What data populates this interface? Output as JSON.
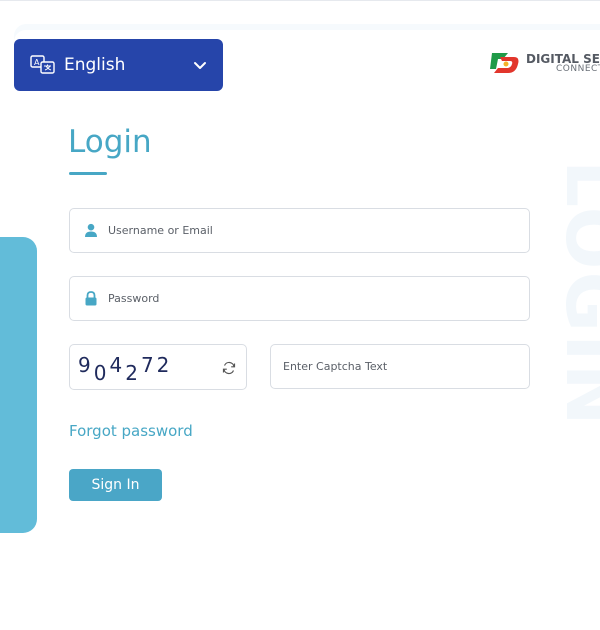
{
  "language": {
    "selected": "English",
    "icon": "translate-icon",
    "chevron": "chevron-down-icon"
  },
  "brand": {
    "title": "DIGITAL SEVA",
    "subtitle": "CONNECT"
  },
  "watermark": "LOGIN",
  "login": {
    "title": "Login",
    "username_placeholder": "Username or Email",
    "password_placeholder": "Password",
    "captcha_value": "904272",
    "captcha_placeholder": "Enter Captcha Text",
    "forgot_label": "Forgot password",
    "signin_label": "Sign In"
  },
  "colors": {
    "primary": "#2645aa",
    "accent": "#47a7c5",
    "panel": "#62bcd9"
  }
}
